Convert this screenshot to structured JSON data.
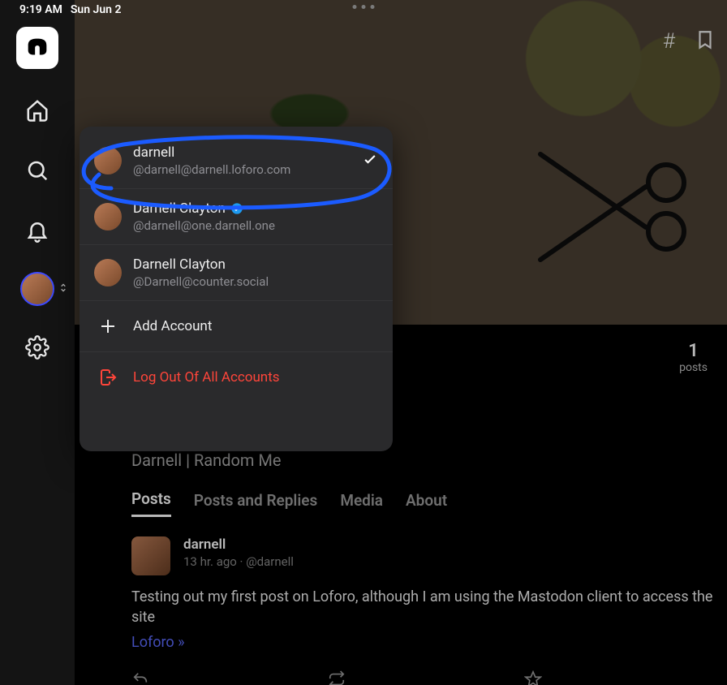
{
  "status": {
    "time": "9:19 AM",
    "date": "Sun Jun 2"
  },
  "hero_icons": {
    "hash": "#"
  },
  "stats": {
    "posts_count": "1",
    "posts_label": "posts"
  },
  "profile": {
    "display_line": "Darnell | Random Me"
  },
  "tabs": {
    "posts": "Posts",
    "posts_replies": "Posts and Replies",
    "media": "Media",
    "about": "About"
  },
  "post": {
    "author": "darnell",
    "meta": "13 hr. ago · @darnell",
    "body": "Testing out my first post on Loforo, although I am using the Mastodon client to access the site",
    "link": "Loforo »"
  },
  "switcher": {
    "accounts": [
      {
        "name": "darnell",
        "handle": "@darnell@darnell.loforo.com",
        "selected": true,
        "verified": false
      },
      {
        "name": "Darnell Clayton",
        "handle": "@darnell@one.darnell.one",
        "selected": false,
        "verified": true
      },
      {
        "name": "Darnell Clayton",
        "handle": "@Darnell@counter.social",
        "selected": false,
        "verified": false
      }
    ],
    "add_label": "Add Account",
    "logout_label": "Log Out Of All Accounts"
  }
}
